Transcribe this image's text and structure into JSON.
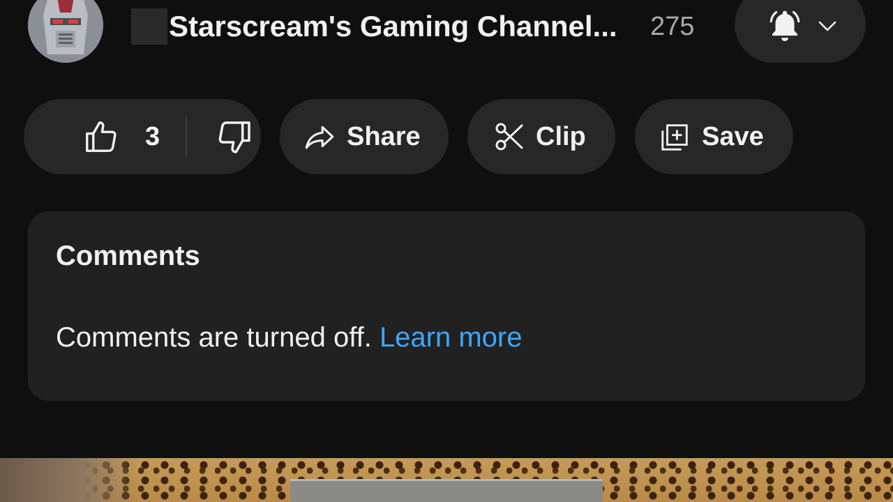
{
  "channel": {
    "name": "Starscream's Gaming Channel...",
    "subscriber_count": "275",
    "avatar_icon": "robot-head-avatar",
    "bell_icon": "bell-filled-icon",
    "menu_icon": "chevron-down-icon"
  },
  "actions": {
    "like_count": "3",
    "like_icon": "thumbs-up-icon",
    "dislike_icon": "thumbs-down-icon",
    "share_label": "Share",
    "share_icon": "share-arrow-icon",
    "clip_label": "Clip",
    "clip_icon": "scissors-icon",
    "save_label": "Save",
    "save_icon": "playlist-add-icon"
  },
  "comments": {
    "title": "Comments",
    "message": "Comments are turned off.",
    "link_label": "Learn more"
  },
  "colors": {
    "background": "#0f0f0f",
    "pill": "#272727",
    "card": "#212121",
    "link": "#3ea6ff",
    "muted_text": "#aaaaaa"
  }
}
